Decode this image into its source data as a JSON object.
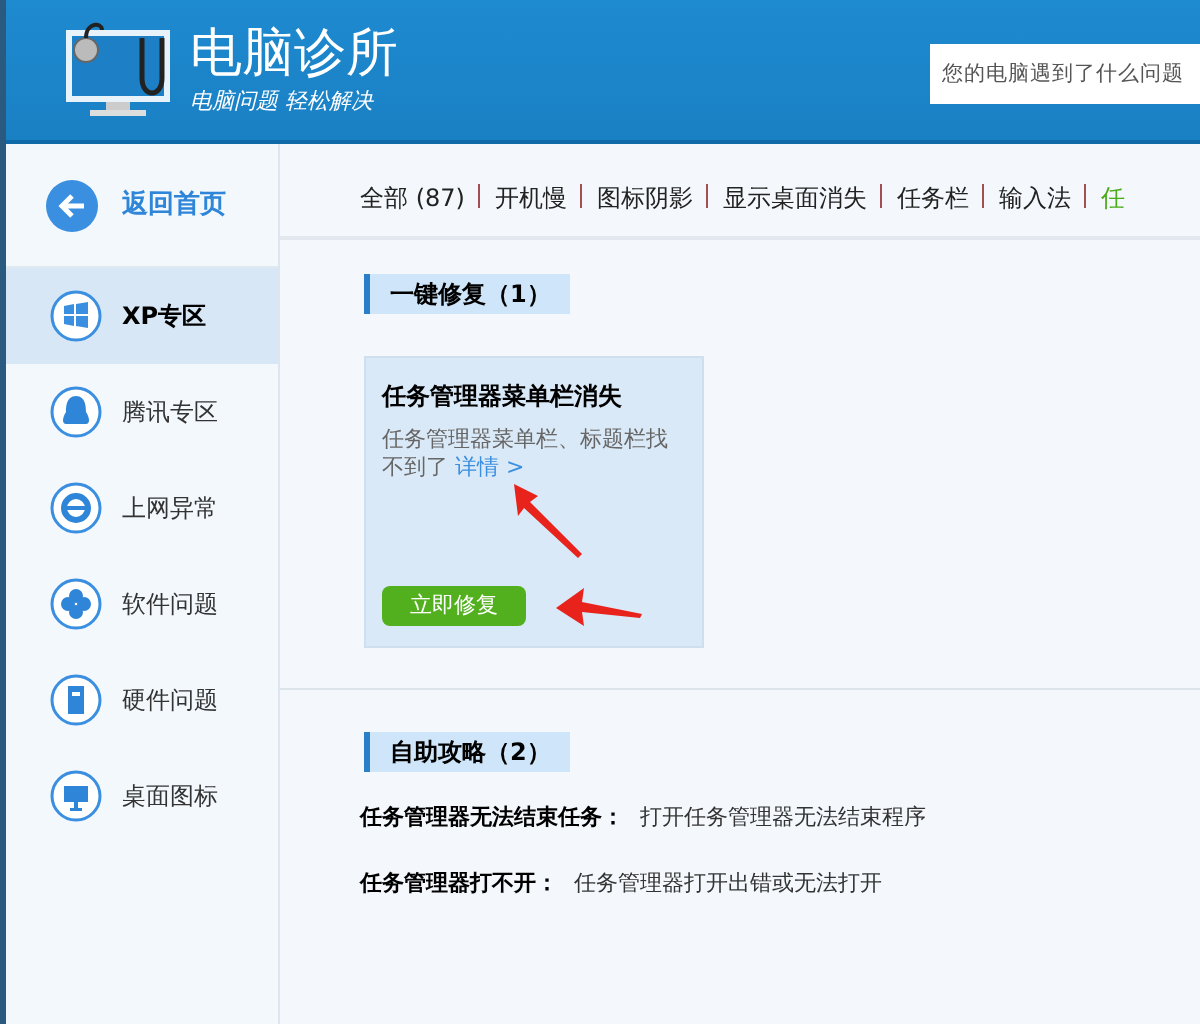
{
  "header": {
    "app_name": "电脑诊所",
    "slogan": "电脑问题 轻松解决",
    "search": {
      "placeholder": "您的电脑遇到了什么问题"
    }
  },
  "sidebar": {
    "back": {
      "label": "返回首页"
    },
    "items": [
      {
        "label": "XP专区",
        "kind": "windows",
        "selected": true
      },
      {
        "label": "腾讯专区",
        "kind": "penguin",
        "selected": false
      },
      {
        "label": "上网异常",
        "kind": "browser",
        "selected": false
      },
      {
        "label": "软件问题",
        "kind": "clover",
        "selected": false
      },
      {
        "label": "硬件问题",
        "kind": "tower",
        "selected": false
      },
      {
        "label": "桌面图标",
        "kind": "monitor",
        "selected": false
      }
    ]
  },
  "tabs": [
    {
      "label": "全部 (87)",
      "selected": false
    },
    {
      "label": "开机慢",
      "selected": false
    },
    {
      "label": "图标阴影",
      "selected": false
    },
    {
      "label": "显示桌面消失",
      "selected": false
    },
    {
      "label": "任务栏",
      "selected": false
    },
    {
      "label": "输入法",
      "selected": false
    },
    {
      "label": "任",
      "selected": true
    }
  ],
  "quick_fix": {
    "heading": "一键修复（1）",
    "cards": [
      {
        "title": "任务管理器菜单栏消失",
        "description": "任务管理器菜单栏、标题栏找不到了",
        "details_link": "详情 >",
        "button": "立即修复"
      }
    ]
  },
  "self_help": {
    "heading": "自助攻略（2）",
    "items": [
      {
        "title": "任务管理器无法结束任务：",
        "description": "打开任务管理器无法结束程序"
      },
      {
        "title": "任务管理器打不开：",
        "description": "任务管理器打开出错或无法打开"
      }
    ]
  }
}
